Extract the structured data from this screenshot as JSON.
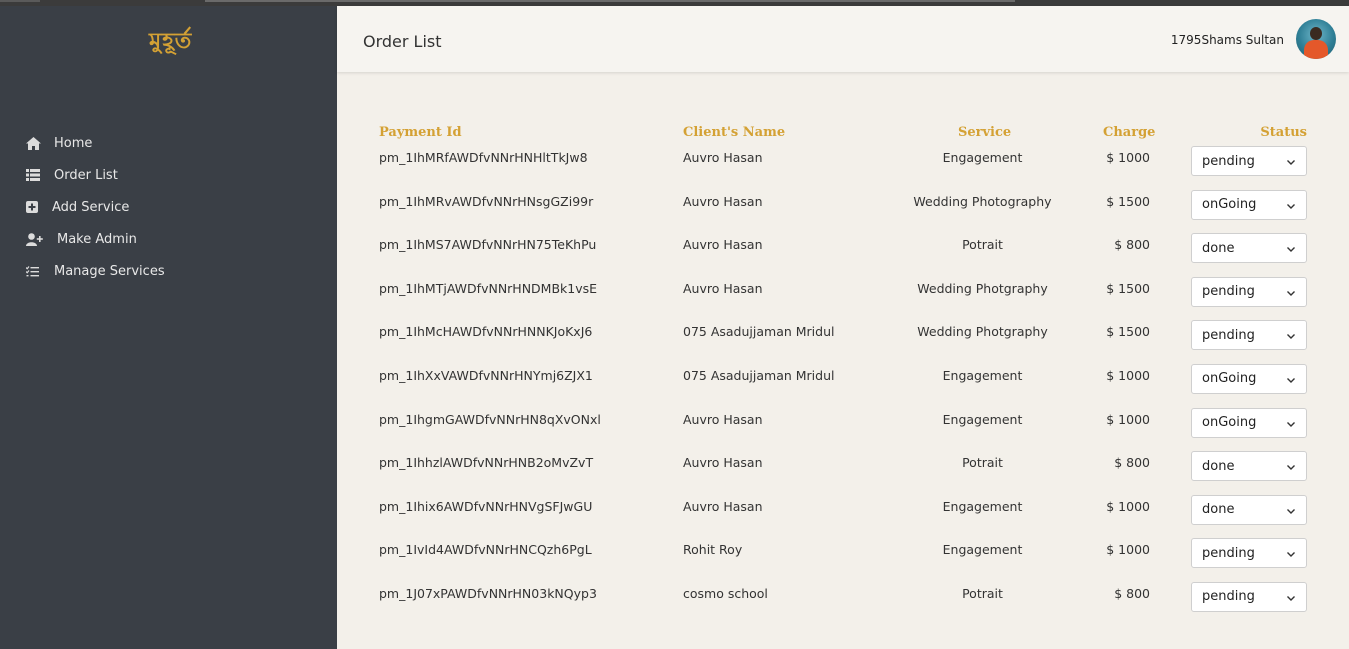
{
  "app": {
    "logo_text": "মুহূর্ত",
    "page_title": "Order List",
    "user_name": "1795Shams Sultan"
  },
  "sidebar": {
    "items": [
      {
        "label": "Home",
        "icon": "home-icon"
      },
      {
        "label": "Order List",
        "icon": "list-icon"
      },
      {
        "label": "Add Service",
        "icon": "plus-square-icon"
      },
      {
        "label": "Make Admin",
        "icon": "user-plus-icon"
      },
      {
        "label": "Manage Services",
        "icon": "tasks-icon"
      }
    ]
  },
  "table": {
    "headers": {
      "payment_id": "Payment Id",
      "client": "Client's Name",
      "service": "Service",
      "charge": "Charge",
      "status": "Status"
    },
    "rows": [
      {
        "payment_id": "pm_1IhMRfAWDfvNNrHNHltTkJw8",
        "client": "Auvro Hasan",
        "service": "Engagement",
        "charge": "$ 1000",
        "status": "pending"
      },
      {
        "payment_id": "pm_1IhMRvAWDfvNNrHNsgGZi99r",
        "client": "Auvro Hasan",
        "service": "Wedding Photography",
        "charge": "$ 1500",
        "status": "onGoing"
      },
      {
        "payment_id": "pm_1IhMS7AWDfvNNrHN75TeKhPu",
        "client": "Auvro Hasan",
        "service": "Potrait",
        "charge": "$ 800",
        "status": "done"
      },
      {
        "payment_id": "pm_1IhMTjAWDfvNNrHNDMBk1vsE",
        "client": "Auvro Hasan",
        "service": "Wedding Photgraphy",
        "charge": "$ 1500",
        "status": "pending"
      },
      {
        "payment_id": "pm_1IhMcHAWDfvNNrHNNKJoKxJ6",
        "client": "075 Asadujjaman Mridul",
        "service": "Wedding Photgraphy",
        "charge": "$ 1500",
        "status": "pending"
      },
      {
        "payment_id": "pm_1IhXxVAWDfvNNrHNYmj6ZJX1",
        "client": "075 Asadujjaman Mridul",
        "service": "Engagement",
        "charge": "$ 1000",
        "status": "onGoing"
      },
      {
        "payment_id": "pm_1IhgmGAWDfvNNrHN8qXvONxl",
        "client": "Auvro Hasan",
        "service": "Engagement",
        "charge": "$ 1000",
        "status": "onGoing"
      },
      {
        "payment_id": "pm_1IhhzlAWDfvNNrHNB2oMvZvT",
        "client": "Auvro Hasan",
        "service": "Potrait",
        "charge": "$ 800",
        "status": "done"
      },
      {
        "payment_id": "pm_1Ihix6AWDfvNNrHNVgSFJwGU",
        "client": "Auvro Hasan",
        "service": "Engagement",
        "charge": "$ 1000",
        "status": "done"
      },
      {
        "payment_id": "pm_1IvId4AWDfvNNrHNCQzh6PgL",
        "client": "Rohit Roy",
        "service": "Engagement",
        "charge": "$ 1000",
        "status": "pending"
      },
      {
        "payment_id": "pm_1J07xPAWDfvNNrHN03kNQyp3",
        "client": "cosmo school",
        "service": "Potrait",
        "charge": "$ 800",
        "status": "pending"
      }
    ]
  },
  "colors": {
    "sidebar_bg": "#3a3f46",
    "accent": "#d4a134",
    "content_bg": "#f3f0ea"
  }
}
